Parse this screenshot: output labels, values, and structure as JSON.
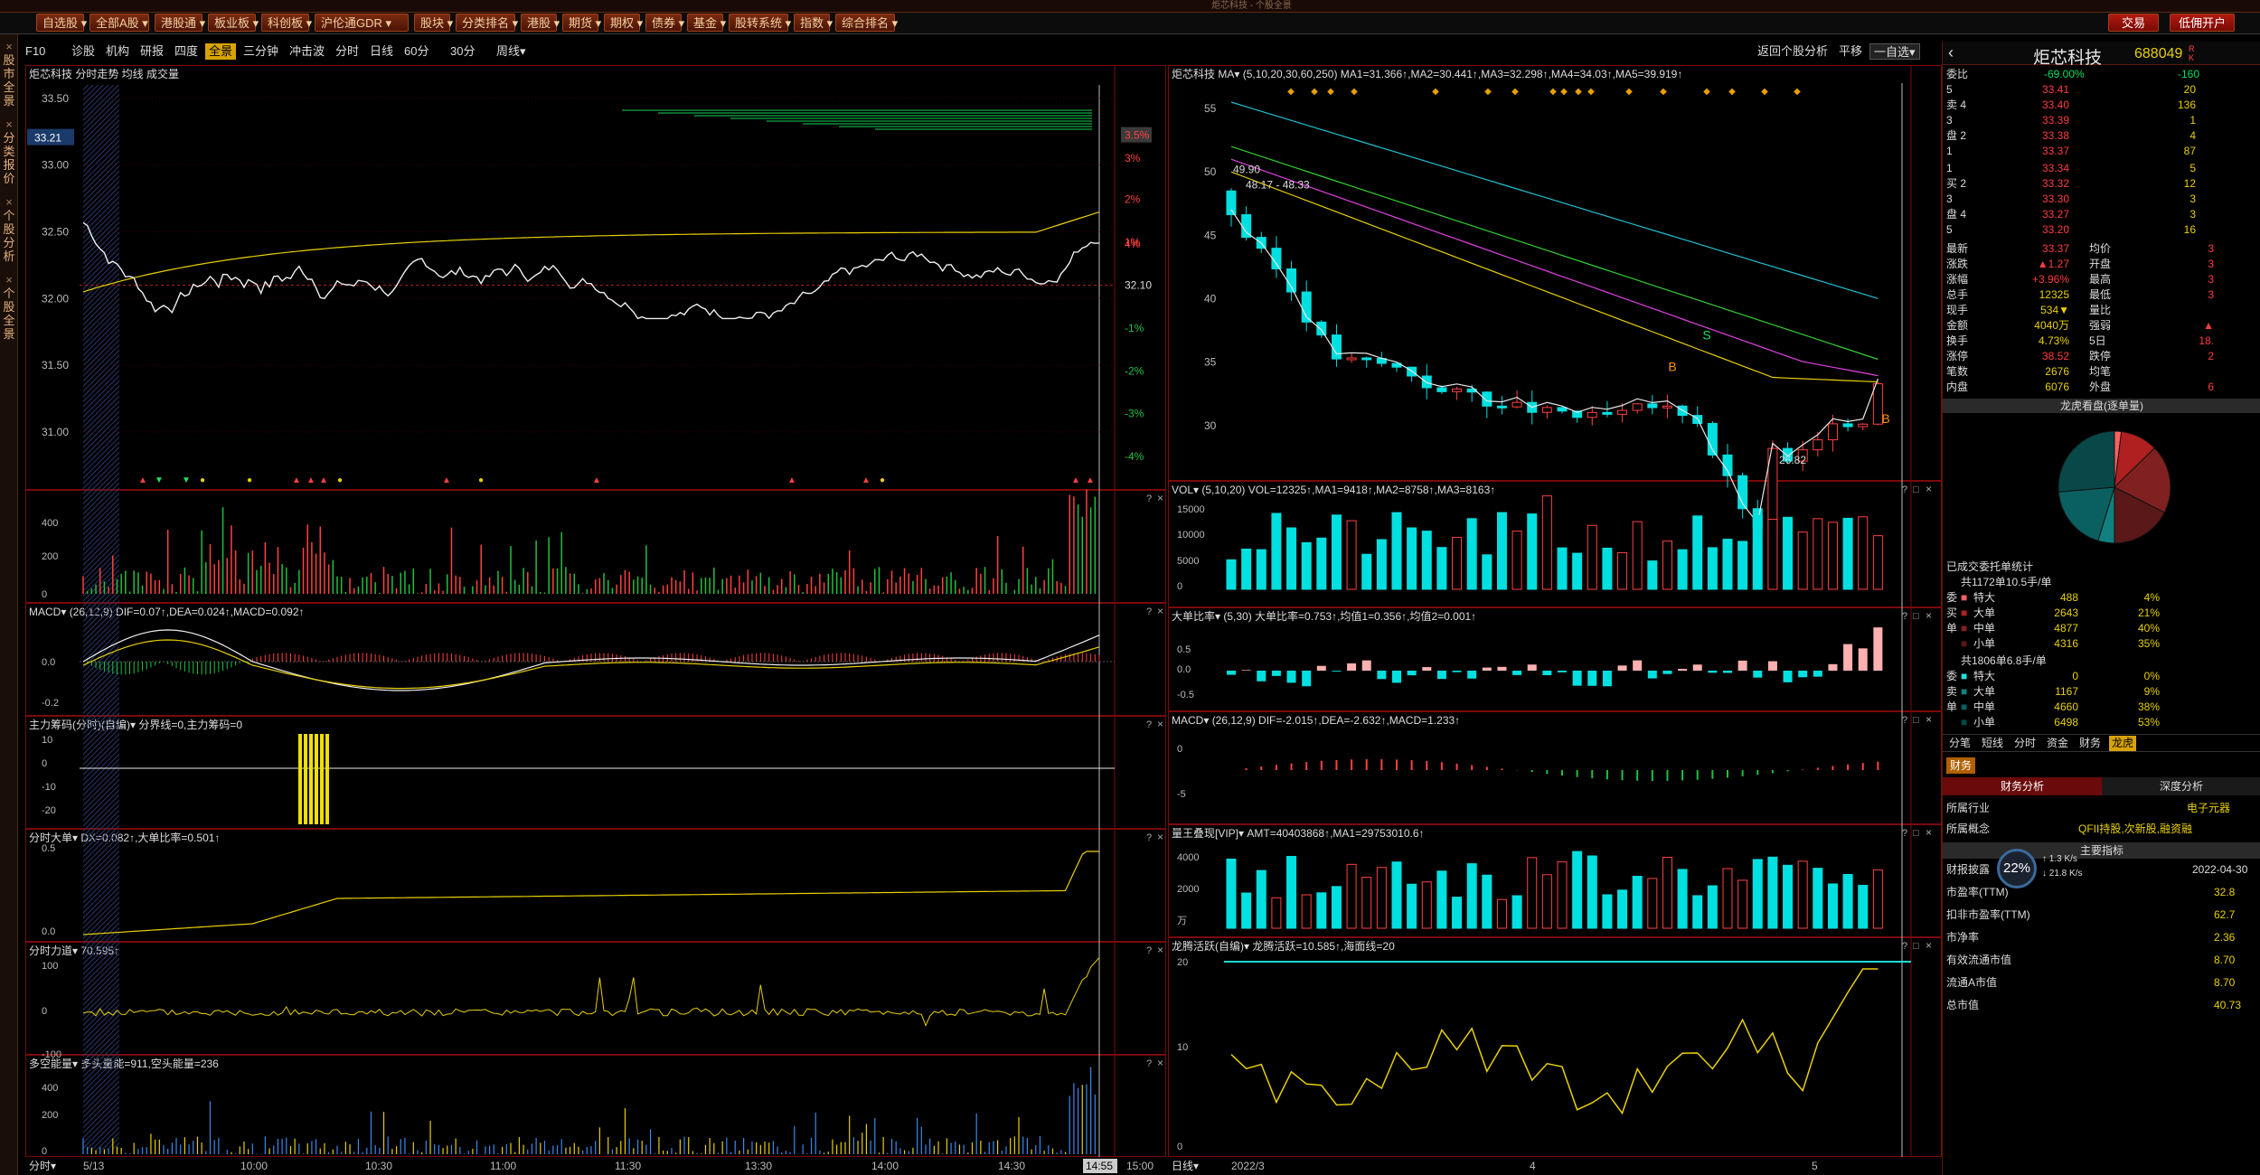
{
  "top_bar": {
    "title": "炬芯科技 - 个股全景"
  },
  "toolbar": {
    "items": [
      "自选股",
      "全部A股",
      "港股通",
      "板业板",
      "科创板",
      "沪伦通GDR",
      "股块",
      "分类排名",
      "港股",
      "期货",
      "期权",
      "债券",
      "基金",
      "股转系统",
      "指数",
      "综合排名"
    ],
    "trade_label": "交易",
    "open_account_label": "低佣开户"
  },
  "left_tabs": [
    "股市全景",
    "分类报价",
    "个股分析",
    "个股全景"
  ],
  "subbar": {
    "left_items": [
      "F10",
      "诊股",
      "机构",
      "研报",
      "四度",
      "全景",
      "三分钟",
      "冲击波",
      "分时",
      "日线",
      "60分",
      "30分",
      "周线▾"
    ],
    "active": "全景",
    "right_items": [
      "返回个股分析",
      "平移",
      "一自选▾"
    ]
  },
  "intraday": {
    "title": "炬芯科技  分时走势  均线  成交量",
    "current_price_tag": "33.21",
    "price_labels": [
      "33.50",
      "33.00",
      "32.50",
      "32.00",
      "31.50",
      "31.00"
    ],
    "pct_labels": [
      "4%",
      "3.5%",
      "3%",
      "2%",
      "1%",
      "32.10",
      "-1%",
      "-2%",
      "-3%",
      "-4%"
    ],
    "time_labels": [
      "5/13",
      "10:00",
      "10:30",
      "11:00",
      "11:30",
      "13:30",
      "14:00",
      "14:30",
      "14:55",
      "15:00"
    ],
    "time_axis_label": "分时▾",
    "vol_labels": [
      "400",
      "200",
      "0"
    ],
    "macd_title": "MACD▾ (26,12,9) DIF=0.07↑,DEA=0.024↑,MACD=0.092↑",
    "macd_labels": [
      "0.0",
      "-0.2"
    ],
    "zlcm_title": "主力筹码(分时)(自编)▾  分界线=0,主力筹码=0",
    "zlcm_labels": [
      "10",
      "0",
      "-10",
      "-20"
    ],
    "fsdd_title": "分时大单▾  DX=0.082↑,大单比率=0.501↑",
    "fsdd_labels": [
      "0.5",
      "0.0"
    ],
    "fsld_title": "分时力道▾  70.595↑",
    "fsld_labels": [
      "100",
      "0",
      "-100"
    ],
    "dkn_title": "多空能量▾  多头量能=911,空头能量=236",
    "dkn_labels": [
      "400",
      "200",
      "0"
    ]
  },
  "daily": {
    "title": "炬芯科技  MA▾ (5,10,20,30,60,250) MA1=31.366↑,MA2=30.441↑,MA3=32.298↑,MA4=34.03↑,MA5=39.919↑",
    "price_labels": [
      "55",
      "50",
      "45",
      "40",
      "35",
      "30"
    ],
    "hi_label": "49.90",
    "hi2_label": "48.17 - 48.33",
    "lo_label": "26.82",
    "vol_title": "VOL▾ (5,10,20) VOL=12325↑,MA1=9418↑,MA2=8758↑,MA3=8163↑",
    "vol_labels": [
      "15000",
      "10000",
      "5000",
      "0"
    ],
    "ddbl_title": "大单比率▾ (5,30) 大单比率=0.753↑,均值1=0.356↑,均值2=0.001↑",
    "ddbl_labels": [
      "0.5",
      "0.0",
      "-0.5"
    ],
    "macd_title": "MACD▾ (26,12,9) DIF=-2.015↑,DEA=-2.632↑,MACD=1.233↑",
    "macd_labels": [
      "0",
      "-5"
    ],
    "lwz_title": "量王叠现[VIP]▾ AMT=40403868↑,MA1=29753010.6↑",
    "lwz_labels": [
      "4000",
      "2000",
      "万"
    ],
    "lthy_title": "龙腾活跃(自编)▾  龙腾活跃=10.585↑,海面线=20",
    "lthy_labels": [
      "20",
      "10",
      "0"
    ],
    "date_labels": [
      "2022/3",
      "4",
      "5"
    ],
    "axis_label": "日线▾"
  },
  "right_panel": {
    "name": "炬芯科技",
    "code": "688049",
    "wb_label": "委比",
    "wb_value": "-69.00%",
    "wc_value": "-160",
    "sells": [
      {
        "l": "5",
        "p": "33.41",
        "v": "20"
      },
      {
        "l": "卖 4",
        "p": "33.40",
        "v": "136"
      },
      {
        "l": "3",
        "p": "33.39",
        "v": "1"
      },
      {
        "l": "盘 2",
        "p": "33.38",
        "v": "4"
      },
      {
        "l": "1",
        "p": "33.37",
        "v": "87"
      }
    ],
    "buys": [
      {
        "l": "1",
        "p": "33.34",
        "v": "5"
      },
      {
        "l": "买 2",
        "p": "33.32",
        "v": "12"
      },
      {
        "l": "3",
        "p": "33.30",
        "v": "3"
      },
      {
        "l": "盘 4",
        "p": "33.27",
        "v": "3"
      },
      {
        "l": "5",
        "p": "33.20",
        "v": "16"
      }
    ],
    "quote": [
      {
        "a": "最新",
        "b": "33.37",
        "c": "均价",
        "d": "3"
      },
      {
        "a": "涨跌",
        "b": "▲1.27",
        "c": "开盘",
        "d": "3"
      },
      {
        "a": "涨幅",
        "b": "+3.96%",
        "c": "最高",
        "d": "3"
      },
      {
        "a": "总手",
        "b": "12325",
        "c": "最低",
        "d": "3"
      },
      {
        "a": "现手",
        "b": "534▼",
        "c": "量比",
        "d": ""
      },
      {
        "a": "金额",
        "b": "4040万",
        "c": "强弱",
        "d": "▲"
      },
      {
        "a": "换手",
        "b": "4.73%",
        "c": "5日",
        "d": "18."
      },
      {
        "a": "涨停",
        "b": "38.52",
        "c": "跌停",
        "d": "2"
      },
      {
        "a": "笔数",
        "b": "2676",
        "c": "均笔",
        "d": ""
      },
      {
        "a": "内盘",
        "b": "6076",
        "c": "外盘",
        "d": "6"
      }
    ],
    "pie_title": "龙虎看盘(逐单量)",
    "orders_title": "已成交委托单统计",
    "buy_summary": "共1172单10.5手/单",
    "buy_rows": [
      {
        "side": "委",
        "n": "特大",
        "v": "488",
        "p": "4%"
      },
      {
        "side": "买",
        "n": "大单",
        "v": "2643",
        "p": "21%"
      },
      {
        "side": "单",
        "n": "中单",
        "v": "4877",
        "p": "40%"
      },
      {
        "side": "",
        "n": "小单",
        "v": "4316",
        "p": "35%"
      }
    ],
    "sell_summary": "共1806单6.8手/单",
    "sell_rows": [
      {
        "side": "委",
        "n": "特大",
        "v": "0",
        "p": "0%"
      },
      {
        "side": "卖",
        "n": "大单",
        "v": "1167",
        "p": "9%"
      },
      {
        "side": "单",
        "n": "中单",
        "v": "4660",
        "p": "38%"
      },
      {
        "side": "",
        "n": "小单",
        "v": "6498",
        "p": "53%"
      }
    ],
    "tabs": [
      "分笔",
      "短线",
      "分时",
      "资金",
      "财务",
      "龙虎"
    ],
    "active_tab": "龙虎",
    "fin_tab": "财务",
    "fin_sub": [
      "财务分析",
      "深度分析"
    ],
    "industry_label": "所属行业",
    "industry_value": "电子元器",
    "concept_label": "所属概念",
    "concept_value": "QFII持股,次新股,融资融",
    "main_index": "主要指标",
    "report_label": "财报披露",
    "report_value": "2022-04-30",
    "net_pct": "22",
    "net_unit": "%",
    "net_up": "1.3",
    "net_down": "21.8",
    "net_speed_unit": "K/s",
    "fin_rows": [
      {
        "a": "市盈率(TTM)",
        "b": "32.8"
      },
      {
        "a": "扣非市盈率(TTM)",
        "b": "62.7"
      },
      {
        "a": "市净率",
        "b": "2.36"
      },
      {
        "a": "有效流通市值",
        "b": "8.70"
      },
      {
        "a": "流通A市值",
        "b": "8.70"
      },
      {
        "a": "总市值",
        "b": "40.73"
      }
    ]
  }
}
